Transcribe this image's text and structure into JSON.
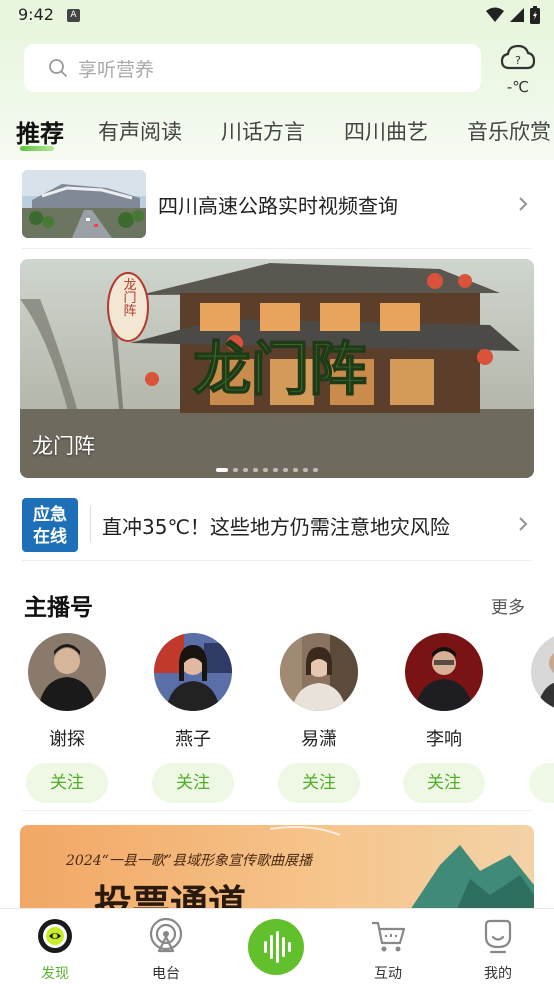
{
  "status_bar": {
    "time": "9:42",
    "notification_badge": "A"
  },
  "search": {
    "placeholder": "享听营养"
  },
  "weather": {
    "temp": "-℃",
    "icon": "cloud-question-icon"
  },
  "tabs": [
    {
      "label": "推荐",
      "active": true
    },
    {
      "label": "有声阅读"
    },
    {
      "label": "川话方言"
    },
    {
      "label": "四川曲艺"
    },
    {
      "label": "音乐欣赏"
    }
  ],
  "promo": {
    "title": "四川高速公路实时视频查询"
  },
  "banner": {
    "caption": "龙门阵",
    "artwork_title": "龙门阵",
    "seal_text": "龙门阵",
    "dot_count": 10,
    "active_dot": 0
  },
  "news": {
    "badge_line1": "应急",
    "badge_line2": "在线",
    "headline": "直冲35℃！这些地方仍需注意地灾风险"
  },
  "hosts_section": {
    "title": "主播号",
    "more": "更多",
    "hosts": [
      {
        "name": "谢探",
        "follow": "关注"
      },
      {
        "name": "燕子",
        "follow": "关注"
      },
      {
        "name": "易潇",
        "follow": "关注"
      },
      {
        "name": "李响",
        "follow": "关注"
      },
      {
        "name": "",
        "follow": ""
      }
    ]
  },
  "vote_banner": {
    "subtitle": "2024“一县一歌”县域形象宣传歌曲展播",
    "title": "投票通道"
  },
  "bottom_nav": [
    {
      "label": "发现",
      "icon": "discover-icon",
      "active": true
    },
    {
      "label": "电台",
      "icon": "radio-icon"
    },
    {
      "label": "",
      "icon": "audio-wave-icon"
    },
    {
      "label": "互动",
      "icon": "cart-icon"
    },
    {
      "label": "我的",
      "icon": "profile-icon"
    }
  ],
  "colors": {
    "accent": "#61c02b",
    "follow_bg": "#eef8e4",
    "follow_text": "#4fae25",
    "badge_blue": "#1d6fb8"
  }
}
